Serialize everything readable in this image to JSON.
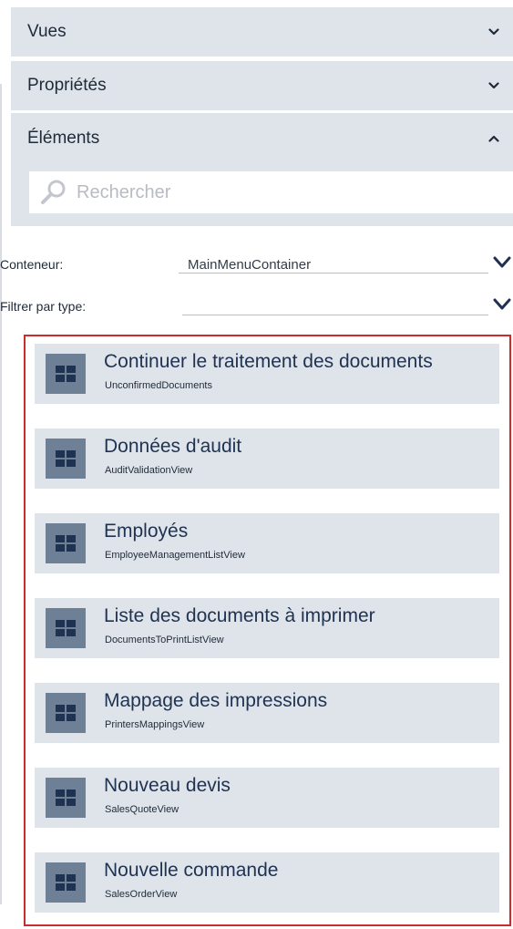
{
  "accordion": {
    "vues": "Vues",
    "proprietes": "Propriétés",
    "elements": "Éléments"
  },
  "search": {
    "placeholder": "Rechercher"
  },
  "fields": {
    "conteneur_label": "Conteneur:",
    "conteneur_value": "MainMenuContainer",
    "filtre_label": "Filtrer par type:",
    "filtre_value": ""
  },
  "items": [
    {
      "title": "Continuer le traitement des documents",
      "subtitle": "UnconfirmedDocuments"
    },
    {
      "title": "Données d'audit",
      "subtitle": "AuditValidationView"
    },
    {
      "title": "Employés",
      "subtitle": "EmployeeManagementListView"
    },
    {
      "title": "Liste des documents à imprimer",
      "subtitle": "DocumentsToPrintListView"
    },
    {
      "title": "Mappage des impressions",
      "subtitle": "PrintersMappingsView"
    },
    {
      "title": "Nouveau devis",
      "subtitle": "SalesQuoteView"
    },
    {
      "title": "Nouvelle commande",
      "subtitle": "SalesOrderView"
    }
  ],
  "colors": {
    "panel": "#dfe4ea",
    "tile": "#6e8096",
    "selection_border": "#cc2b2b",
    "accent_chevron": "#1f3251"
  },
  "icons": {
    "collapsed": "chevron-down-icon",
    "expanded": "chevron-up-icon",
    "search": "search-icon",
    "tile": "grid-icon"
  }
}
